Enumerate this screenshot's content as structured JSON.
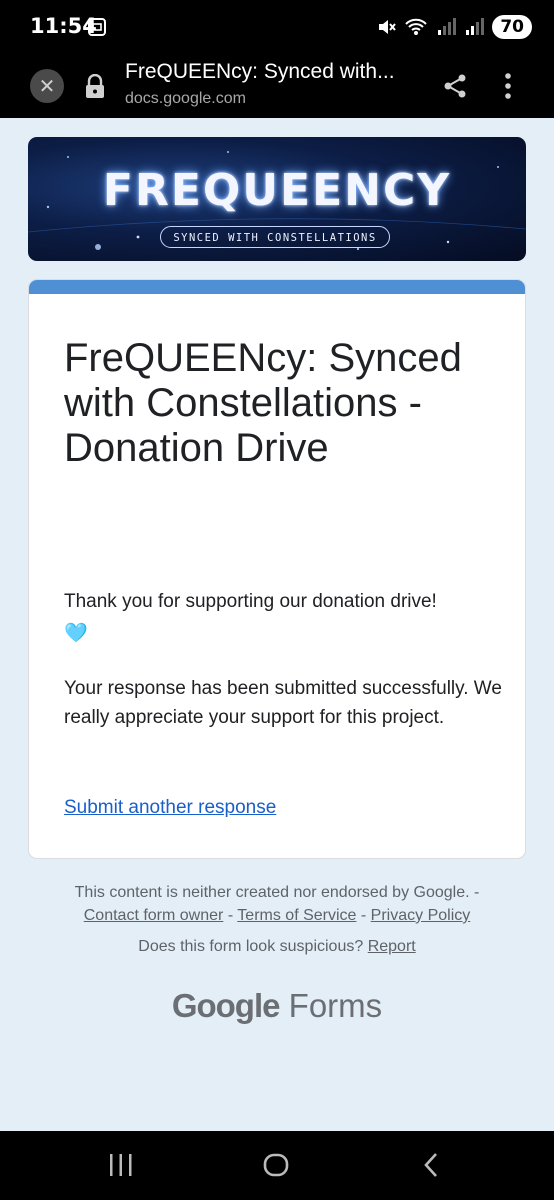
{
  "status_bar": {
    "time": "11:54",
    "battery": "70"
  },
  "browser": {
    "page_title": "FreQUEENcy: Synced with...",
    "url": "docs.google.com"
  },
  "banner": {
    "title": "FREQUEENCY",
    "subtitle": "SYNCED WITH CONSTELLATIONS"
  },
  "form": {
    "title": "FreQUEENcy: Synced with Constellations - Donation Drive",
    "thank_you": "Thank you for supporting our donation drive!",
    "heart": "🩵",
    "response_text": "Your response has been submitted successfully. We really appreciate your support for this project.",
    "another_link": "Submit another response",
    "accent_color": "#4f90d4"
  },
  "footer": {
    "disclaimer": "This content is neither created nor endorsed by Google.",
    "separator": "-",
    "contact": "Contact form owner",
    "terms": "Terms of Service",
    "privacy": "Privacy Policy",
    "suspicious": "Does this form look suspicious?",
    "report": "Report",
    "logo_google": "Google",
    "logo_forms": "Forms"
  }
}
